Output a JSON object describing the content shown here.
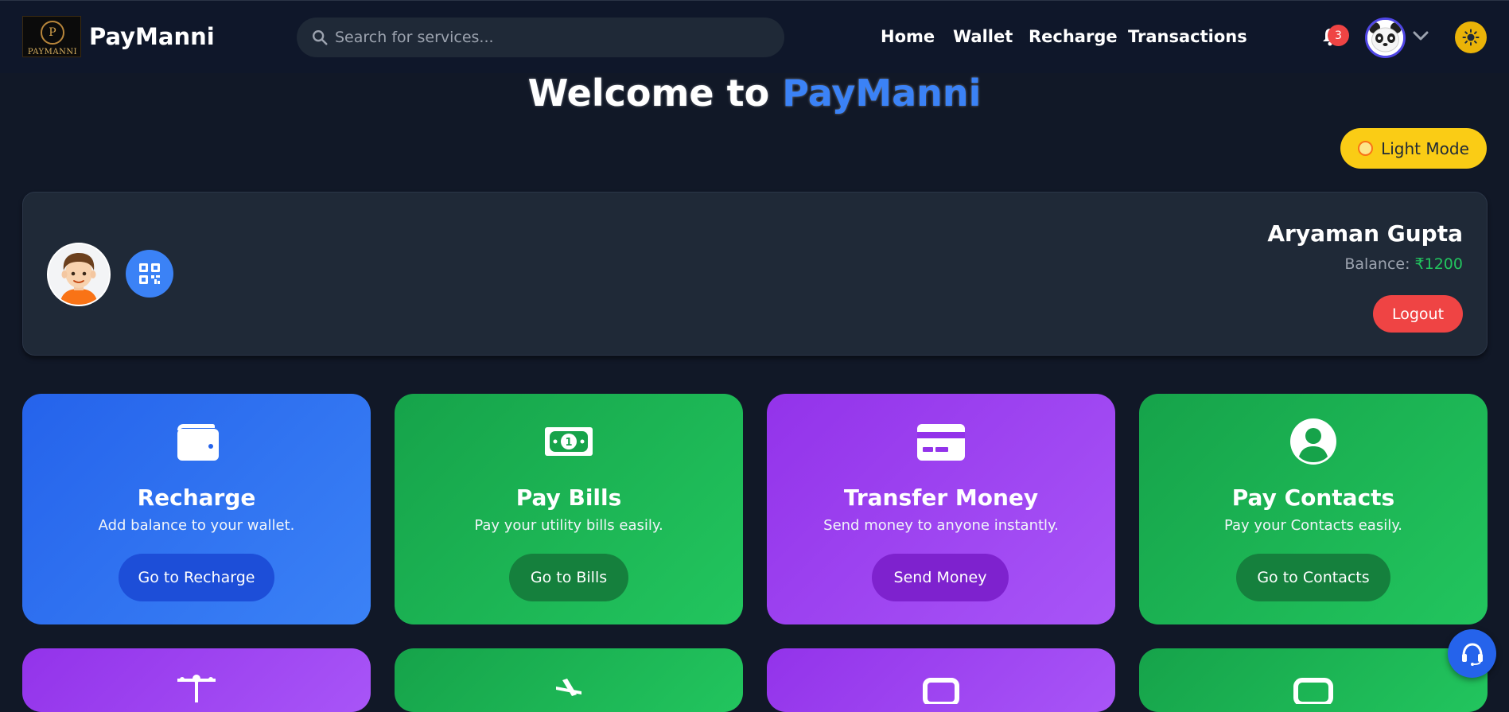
{
  "navbar": {
    "logo_text": "PAYMANNI",
    "logo_letter": "P",
    "brand": "PayManni",
    "search_placeholder": "Search for services...",
    "links": [
      "Home",
      "Wallet",
      "Recharge",
      "Transactions"
    ],
    "notification_count": "3"
  },
  "hero": {
    "welcome_prefix": "Welcome to",
    "welcome_brand": "PayManni",
    "light_mode_label": "Light Mode"
  },
  "profile": {
    "name": "Aryaman Gupta",
    "balance_label": "Balance:",
    "balance_amount": "₹1200",
    "logout_label": "Logout"
  },
  "cards": [
    {
      "title": "Recharge",
      "desc": "Add balance to your wallet.",
      "button": "Go to Recharge",
      "icon": "wallet-icon"
    },
    {
      "title": "Pay Bills",
      "desc": "Pay your utility bills easily.",
      "button": "Go to Bills",
      "icon": "money-bill-icon"
    },
    {
      "title": "Transfer Money",
      "desc": "Send money to anyone instantly.",
      "button": "Send Money",
      "icon": "credit-card-icon"
    },
    {
      "title": "Pay Contacts",
      "desc": "Pay your Contacts easily.",
      "button": "Go to Contacts",
      "icon": "user-circle-icon"
    }
  ],
  "colors": {
    "background": "#111827",
    "navbar": "#0f172a",
    "accent_blue": "#3b82f6",
    "card_green": "#22c55e",
    "card_purple": "#a855f7",
    "danger": "#ef4444",
    "yellow": "#facc15"
  }
}
